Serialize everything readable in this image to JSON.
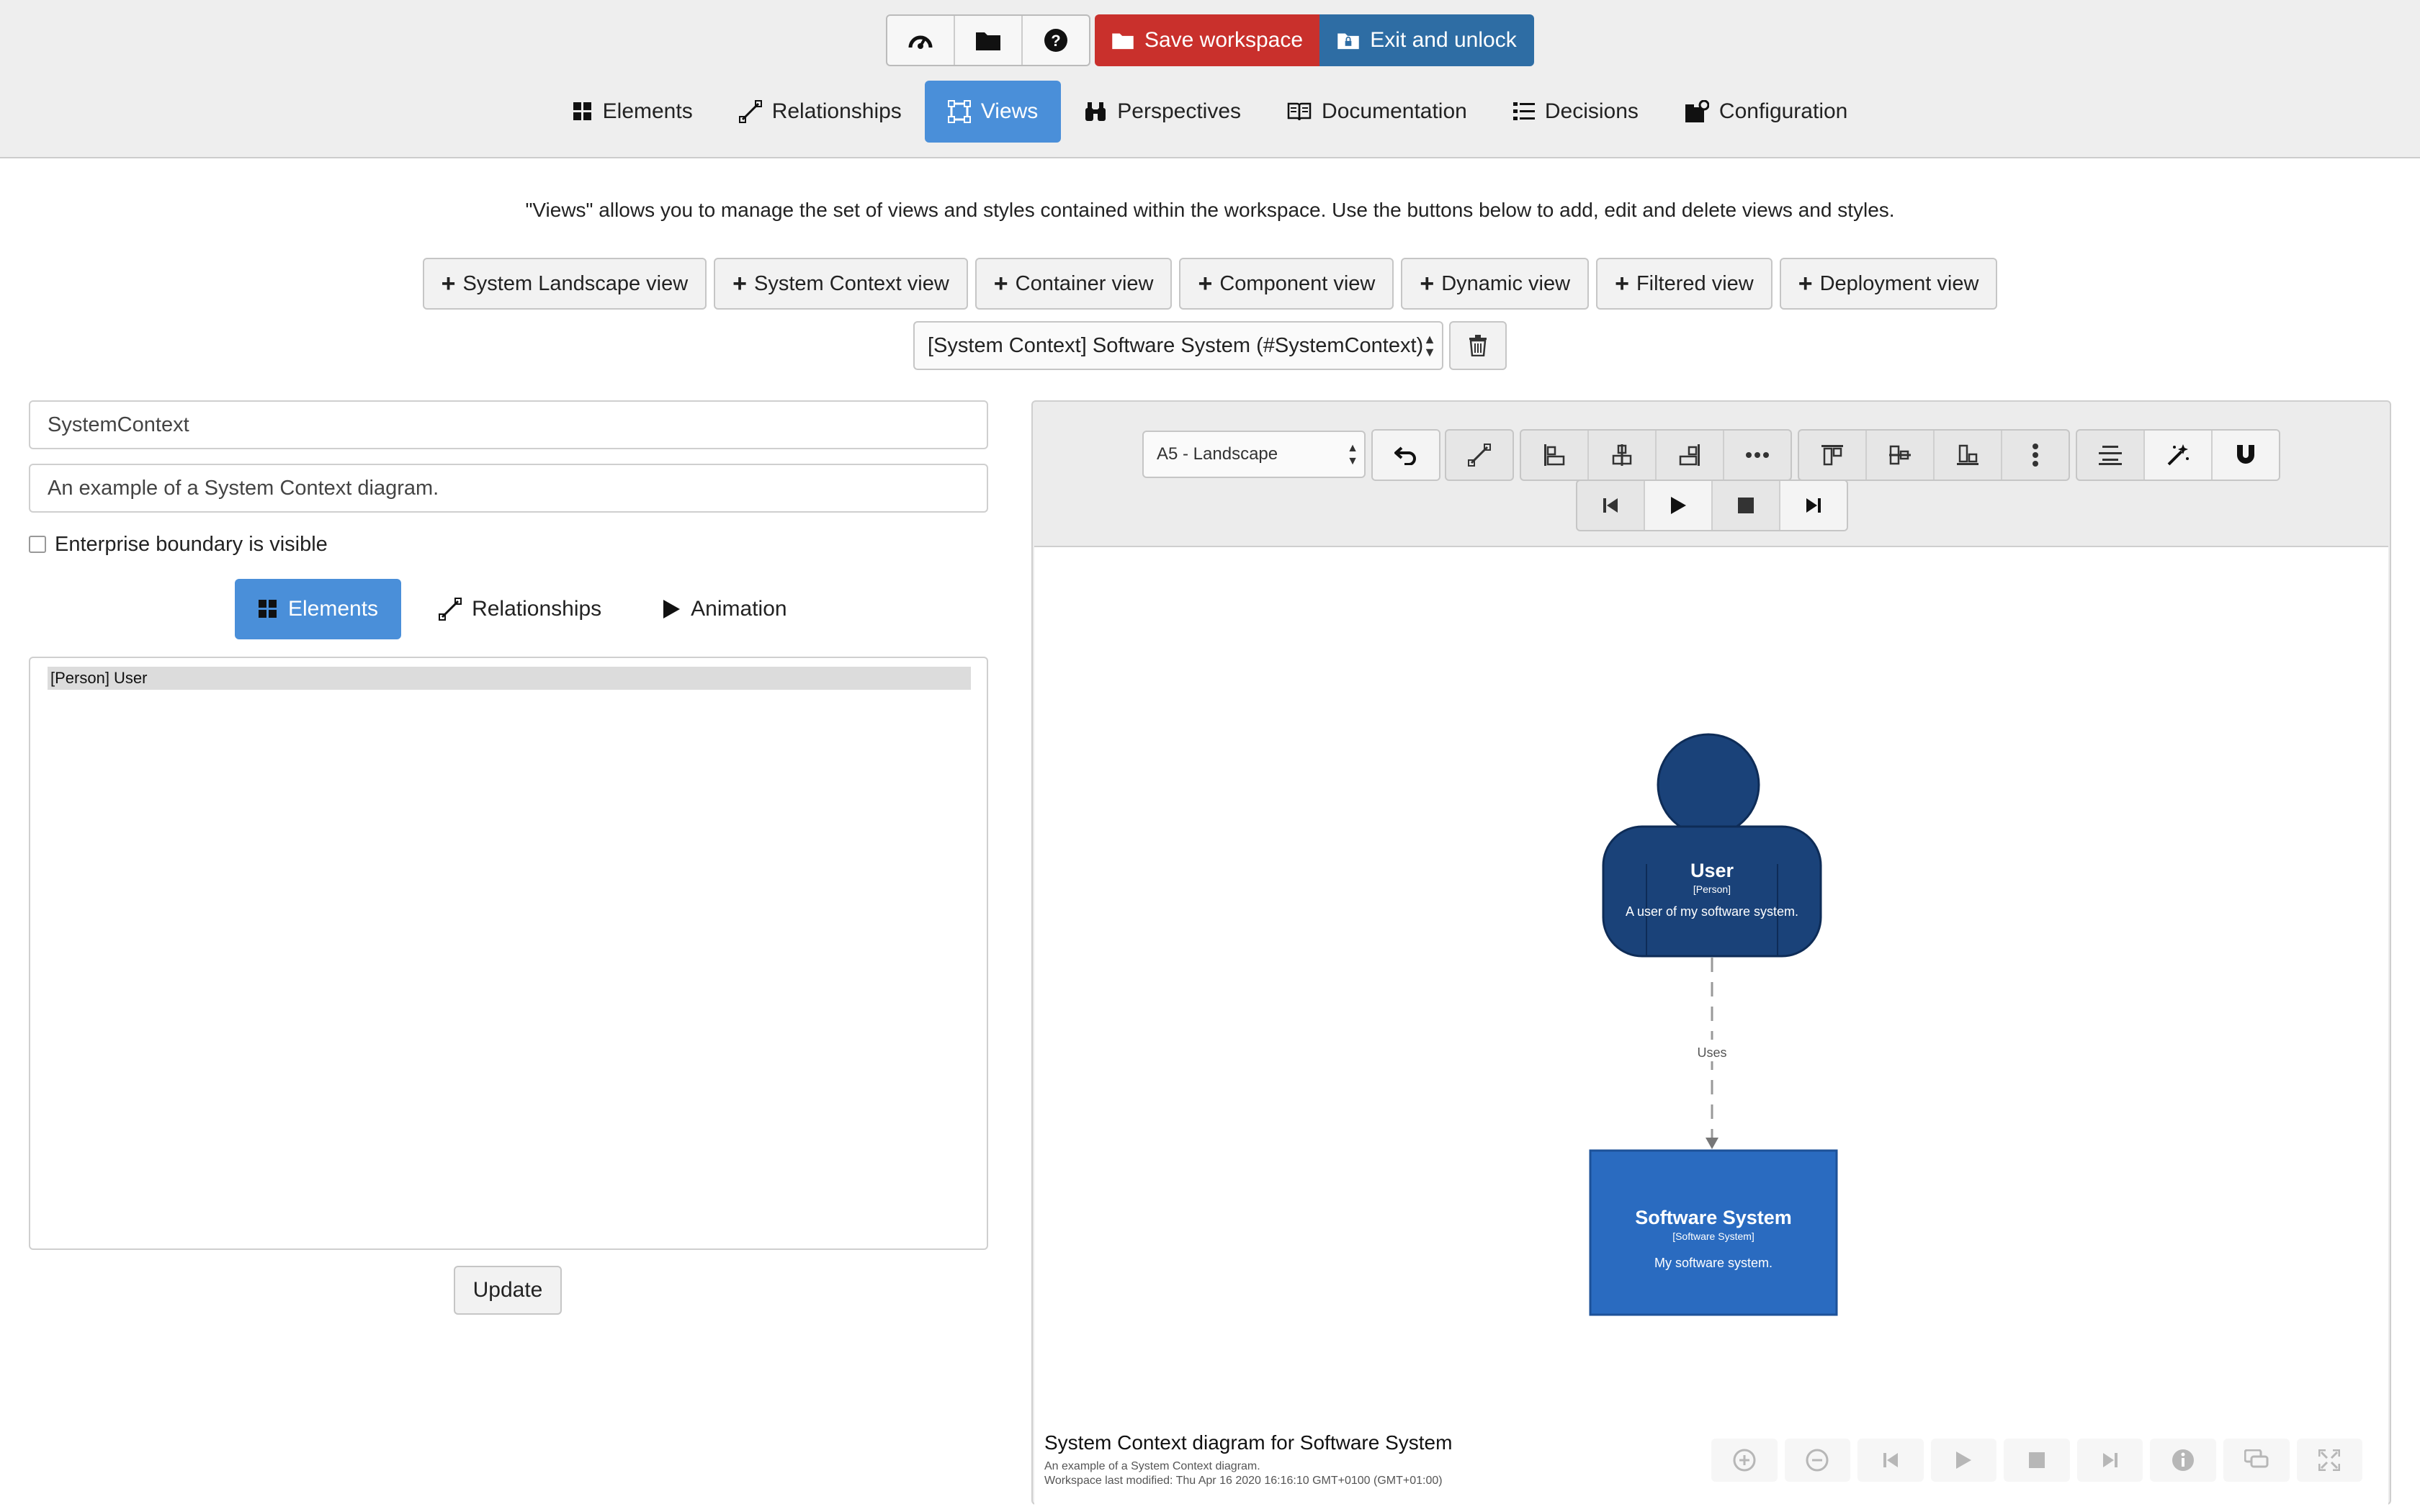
{
  "toolbar": {
    "save_label": "Save workspace",
    "exit_label": "Exit and unlock",
    "icons": [
      "dashboard-icon",
      "folder-icon",
      "help-icon"
    ]
  },
  "nav": {
    "tabs": [
      {
        "label": "Elements",
        "icon": "grid-icon"
      },
      {
        "label": "Relationships",
        "icon": "relationship-icon"
      },
      {
        "label": "Views",
        "icon": "views-icon",
        "active": true
      },
      {
        "label": "Perspectives",
        "icon": "binoculars-icon"
      },
      {
        "label": "Documentation",
        "icon": "book-icon"
      },
      {
        "label": "Decisions",
        "icon": "list-icon"
      },
      {
        "label": "Configuration",
        "icon": "config-icon"
      }
    ]
  },
  "intro": "\"Views\" allows you to manage the set of views and styles contained within the workspace. Use the buttons below to add, edit and delete views and styles.",
  "add_buttons": [
    "System Landscape view",
    "System Context view",
    "Container view",
    "Component view",
    "Dynamic view",
    "Filtered view",
    "Deployment view"
  ],
  "view_select": {
    "value": "[System Context] Software System (#SystemContext)"
  },
  "form": {
    "key": "SystemContext",
    "description": "An example of a System Context diagram.",
    "enterprise_boundary_label": "Enterprise boundary is visible"
  },
  "subtabs": [
    {
      "label": "Elements",
      "icon": "grid-icon",
      "active": true
    },
    {
      "label": "Relationships",
      "icon": "relationship-icon"
    },
    {
      "label": "Animation",
      "icon": "play-icon"
    }
  ],
  "element_list": [
    "[Person] User"
  ],
  "update_label": "Update",
  "diagram": {
    "paper_size": "A5 - Landscape",
    "person": {
      "name": "User",
      "type": "[Person]",
      "description": "A user of my software system."
    },
    "relationship": {
      "label": "Uses"
    },
    "system": {
      "name": "Software System",
      "type": "[Software System]",
      "description": "My software system."
    },
    "colors": {
      "person": "#1a4279",
      "system": "#2a6bc0",
      "line": "#999999"
    },
    "caption_title": "System Context diagram for Software System",
    "caption_desc": "An example of a System Context diagram.",
    "caption_modified": "Workspace last modified: Thu Apr 16 2020 16:16:10 GMT+0100 (GMT+01:00)"
  }
}
